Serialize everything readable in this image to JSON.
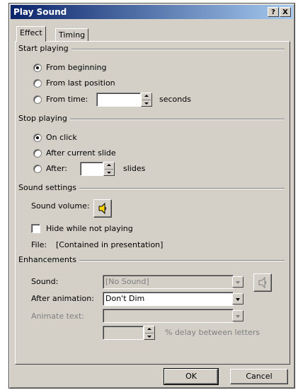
{
  "window": {
    "title": "Play Sound",
    "help_icon": "?",
    "close_icon": "X"
  },
  "tabs": [
    {
      "label": "Effect",
      "selected": true
    },
    {
      "label": "Timing",
      "selected": false
    }
  ],
  "start_playing": {
    "title": "Start playing",
    "options": [
      "From beginning",
      "From last position",
      "From time:"
    ],
    "selected_index": 0,
    "time_value": "",
    "time_unit": "seconds"
  },
  "stop_playing": {
    "title": "Stop playing",
    "options": [
      "On click",
      "After current slide",
      "After:"
    ],
    "selected_index": 0,
    "slides_value": "",
    "slides_unit": "slides"
  },
  "sound_settings": {
    "title": "Sound settings",
    "volume_label": "Sound volume:",
    "volume_icon": "speaker-icon",
    "hide_label": "Hide while not playing",
    "hide_checked": false,
    "file_label": "File:",
    "file_value": "[Contained in presentation]"
  },
  "enhancements": {
    "title": "Enhancements",
    "sound_label": "Sound:",
    "sound_value": "[No Sound]",
    "after_animation_label": "After animation:",
    "after_animation_value": "Don't Dim",
    "animate_text_label": "Animate text:",
    "animate_text_value": "",
    "delay_value": "",
    "delay_label": "% delay between letters"
  },
  "buttons": {
    "ok": "OK",
    "cancel": "Cancel"
  },
  "colors": {
    "face": "#d4d0c8",
    "title_start": "#0a246a",
    "title_end": "#a6caf0",
    "disabled_text": "#808080"
  }
}
